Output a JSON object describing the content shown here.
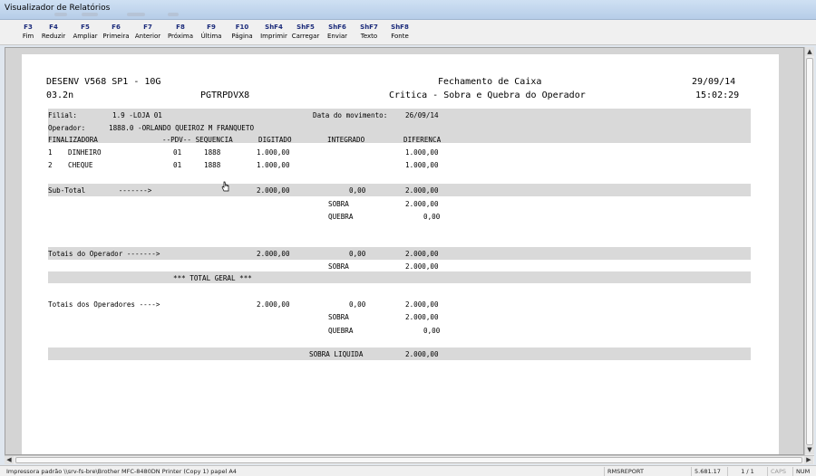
{
  "window": {
    "title": "Visualizador de Relatórios"
  },
  "toolbar": {
    "buttons": [
      {
        "key": "F3",
        "label": "Fim"
      },
      {
        "key": "F4",
        "label": "Reduzir"
      },
      {
        "key": "F5",
        "label": "Ampliar"
      },
      {
        "key": "F6",
        "label": "Primeira"
      },
      {
        "key": "F7",
        "label": "Anterior"
      },
      {
        "key": "F8",
        "label": "Próxima"
      },
      {
        "key": "F9",
        "label": "Última"
      },
      {
        "key": "F10",
        "label": "Página"
      },
      {
        "key": "ShF4",
        "label": "Imprimir"
      },
      {
        "key": "ShF5",
        "label": "Carregar"
      },
      {
        "key": "ShF6",
        "label": "Enviar"
      },
      {
        "key": "ShF7",
        "label": "Texto"
      },
      {
        "key": "ShF8",
        "label": "Fonte"
      }
    ]
  },
  "report": {
    "header": {
      "system": "DESENV V568 SP1 - 10G",
      "title": "Fechamento de Caixa",
      "date": "29/09/14",
      "version": "03.2n",
      "program": "PGTRPDVX8",
      "subtitle": "Critica - Sobra e Quebra do Operador",
      "time": "15:02:29"
    },
    "filial_label": "Filial:",
    "filial_value": "1.9 -LOJA 01",
    "data_mov_label": "Data do movimento:",
    "data_mov_value": "26/09/14",
    "operador_label": "Operador:",
    "operador_value": "1888.0 -ORLANDO QUEIROZ M FRANQUETO",
    "columns": {
      "finalizadora": "FINALIZADORA",
      "pdv_seq": "--PDV-- SEQUENCIA",
      "digitado": "DIGITADO",
      "integrado": "INTEGRADO",
      "diferenca": "DIFERENCA"
    },
    "rows": [
      {
        "num": "1",
        "name": "DINHEIRO",
        "pdv": "01",
        "seq": "1888",
        "digitado": "1.000,00",
        "diferenca": "1.000,00"
      },
      {
        "num": "2",
        "name": "CHEQUE",
        "pdv": "01",
        "seq": "1888",
        "digitado": "1.000,00",
        "diferenca": "1.000,00"
      }
    ],
    "subtotal": {
      "label": "Sub-Total        ------->",
      "digitado": "2.000,00",
      "integrado": "0,00",
      "diferenca": "2.000,00"
    },
    "sub_sobra": {
      "label": "SOBRA",
      "value": "2.000,00"
    },
    "sub_quebra": {
      "label": "QUEBRA",
      "value": "0,00"
    },
    "totais_operador": {
      "label": "Totais do Operador ------->",
      "digitado": "2.000,00",
      "integrado": "0,00",
      "diferenca": "2.000,00"
    },
    "op_sobra": {
      "label": "SOBRA",
      "value": "2.000,00"
    },
    "total_geral": "*** TOTAL GERAL ***",
    "totais_operadores": {
      "label": "Totais dos Operadores ---->",
      "digitado": "2.000,00",
      "integrado": "0,00",
      "diferenca": "2.000,00"
    },
    "ops_sobra": {
      "label": "SOBRA",
      "value": "2.000,00"
    },
    "ops_quebra": {
      "label": "QUEBRA",
      "value": "0,00"
    },
    "sobra_liquida": {
      "label": "SOBRA LIQUIDA",
      "value": "2.000,00"
    }
  },
  "statusbar": {
    "printer": "Impressora padrão \\\\srv-fs-bre\\Brother MFC-8480DN Printer (Copy 1) papel A4",
    "report": "RMSREPORT",
    "version": "5.681.17",
    "page": "1 / 1",
    "caps": "CAPS",
    "num": "NUM"
  }
}
